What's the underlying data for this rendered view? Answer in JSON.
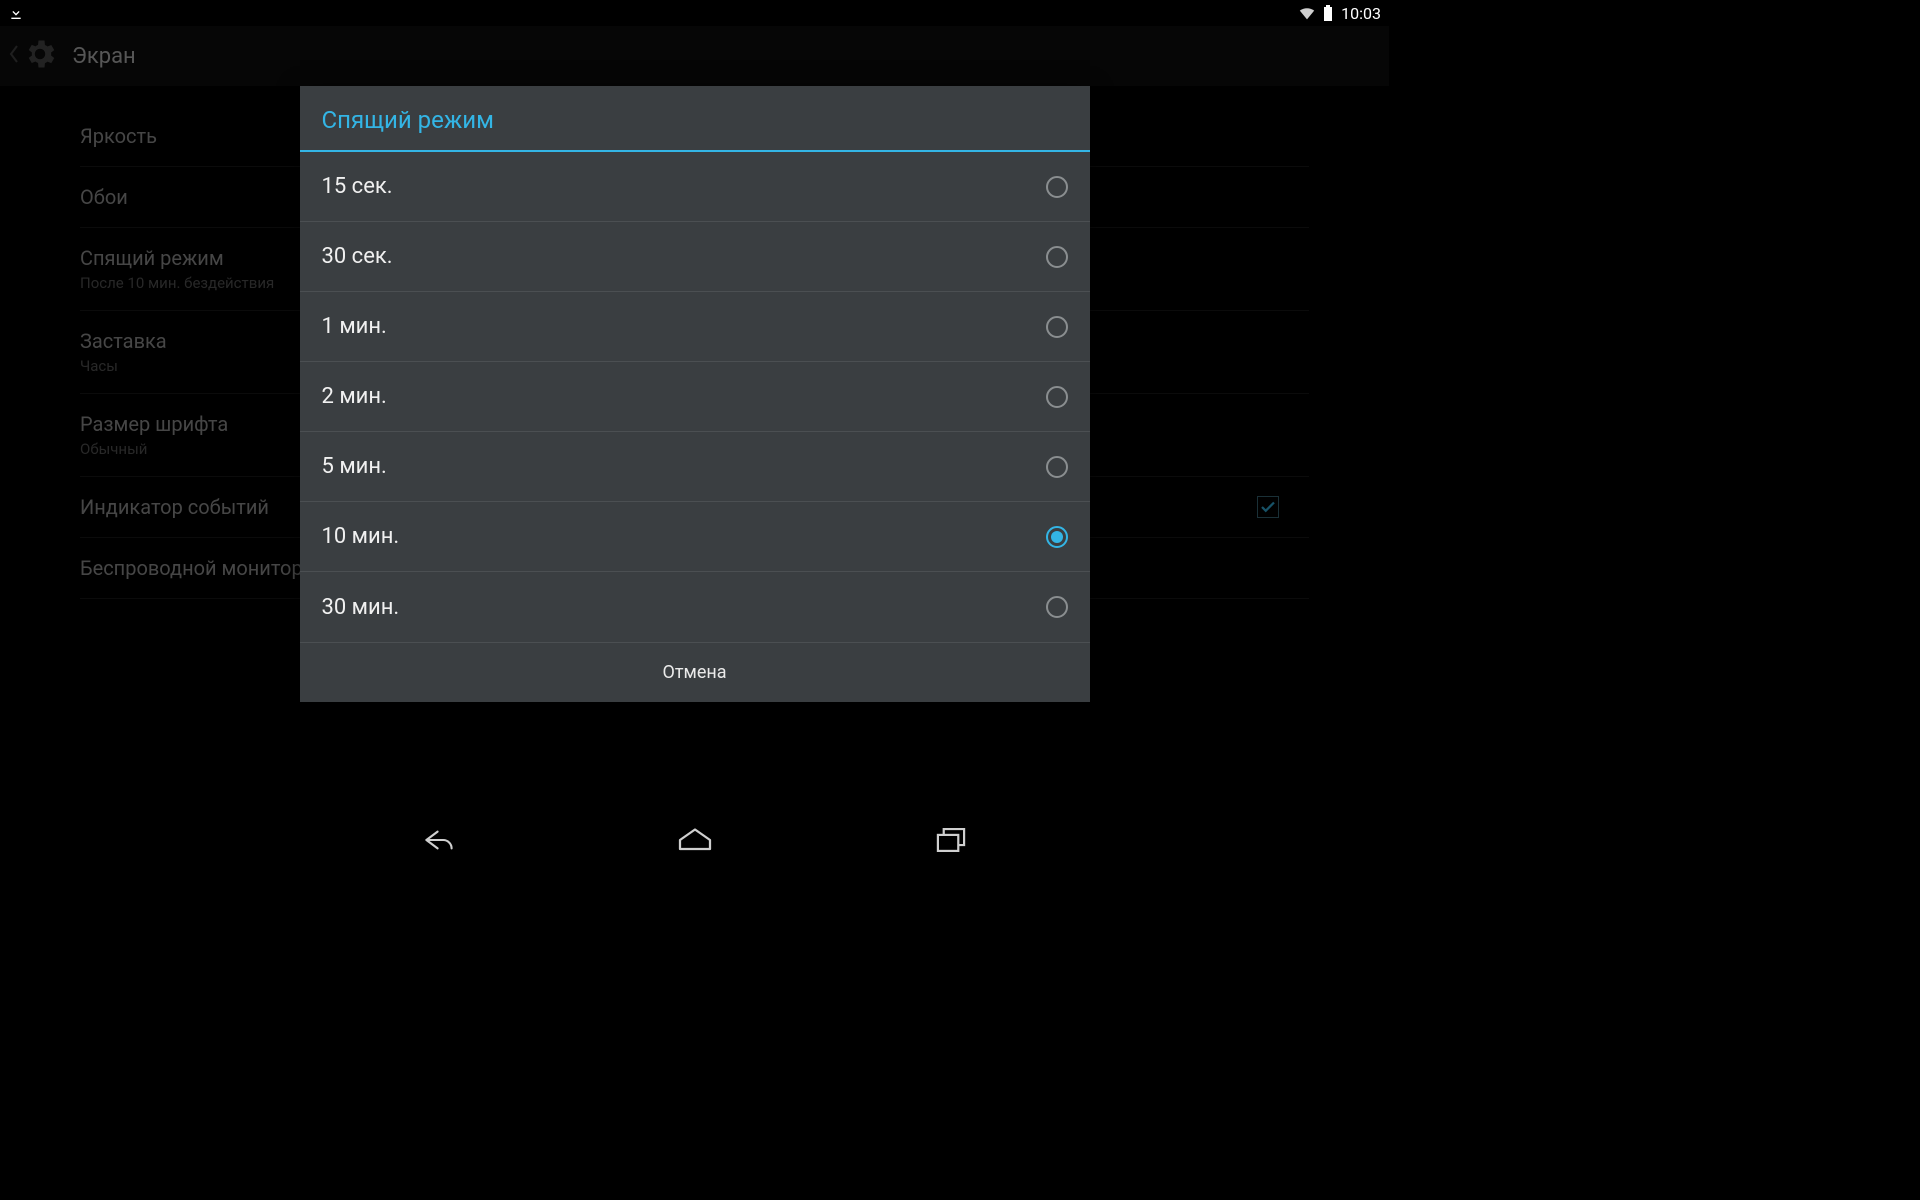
{
  "status": {
    "time": "10:03"
  },
  "actionbar": {
    "title": "Экран"
  },
  "settings": {
    "items": [
      {
        "title": "Яркость",
        "sub": ""
      },
      {
        "title": "Обои",
        "sub": ""
      },
      {
        "title": "Спящий режим",
        "sub": "После 10 мин. бездействия"
      },
      {
        "title": "Заставка",
        "sub": "Часы"
      },
      {
        "title": "Размер шрифта",
        "sub": "Обычный"
      },
      {
        "title": "Индикатор событий",
        "sub": "",
        "checked": true
      },
      {
        "title": "Беспроводной монитор",
        "sub": ""
      }
    ]
  },
  "dialog": {
    "title": "Спящий режим",
    "options": [
      {
        "label": "15 сек.",
        "selected": false
      },
      {
        "label": "30 сек.",
        "selected": false
      },
      {
        "label": "1 мин.",
        "selected": false
      },
      {
        "label": "2 мин.",
        "selected": false
      },
      {
        "label": "5 мин.",
        "selected": false
      },
      {
        "label": "10 мин.",
        "selected": true
      },
      {
        "label": "30 мин.",
        "selected": false
      }
    ],
    "cancel": "Отмена"
  },
  "colors": {
    "accent": "#33b5e5",
    "dialog_bg": "#3a3e41"
  }
}
